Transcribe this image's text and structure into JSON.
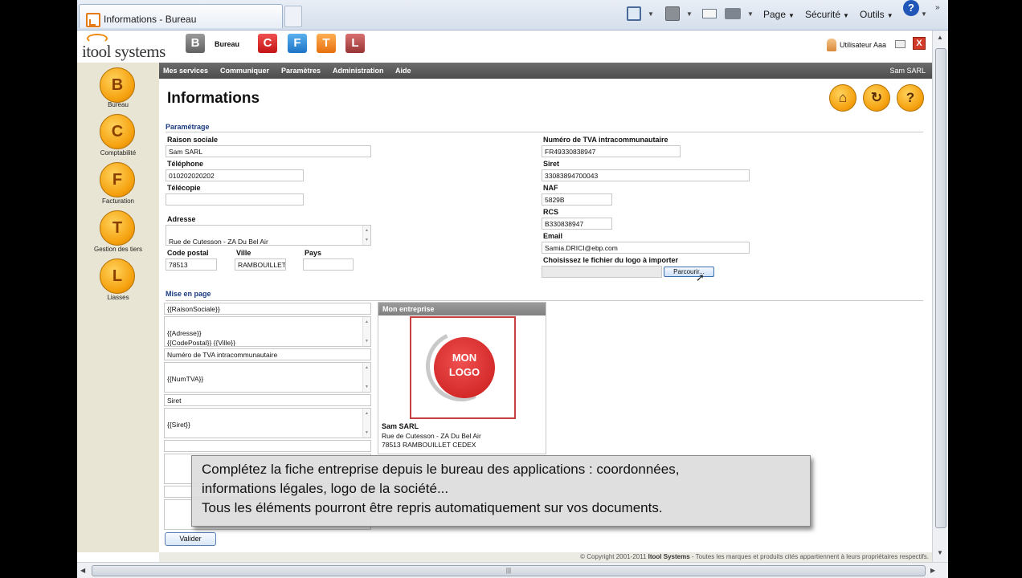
{
  "browser": {
    "tab_title": "Informations - Bureau",
    "menu": [
      "Page",
      "Sécurité",
      "Outils"
    ],
    "overflow": "»"
  },
  "header": {
    "logo_text": "itool systems",
    "apps": [
      {
        "letter": "B",
        "label": "Bureau"
      },
      {
        "letter": "C"
      },
      {
        "letter": "F"
      },
      {
        "letter": "T"
      },
      {
        "letter": "L"
      }
    ],
    "user": "Utilisateur Aaa",
    "close": "X"
  },
  "sidebar": {
    "items": [
      {
        "letter": "B",
        "label": "Bureau"
      },
      {
        "letter": "C",
        "label": "Comptabilité"
      },
      {
        "letter": "F",
        "label": "Facturation"
      },
      {
        "letter": "T",
        "label": "Gestion des tiers"
      },
      {
        "letter": "L",
        "label": "Liasses"
      }
    ]
  },
  "menubar": {
    "items": [
      "Mes services",
      "Communiquer",
      "Paramètres",
      "Administration",
      "Aide"
    ],
    "user": "Sam SARL"
  },
  "page": {
    "title": "Informations",
    "actions": [
      "home",
      "refresh",
      "help"
    ],
    "help_glyph": "?"
  },
  "parametrage": {
    "section_title": "Paramétrage",
    "raison_sociale": {
      "label": "Raison sociale",
      "value": "Sam SARL"
    },
    "telephone": {
      "label": "Téléphone",
      "value": "010202020202"
    },
    "telecopie": {
      "label": "Télécopie",
      "value": ""
    },
    "adresse": {
      "label": "Adresse",
      "value": "Rue de Cutesson - ZA Du Bel Air"
    },
    "code_postal": {
      "label": "Code postal",
      "value": "78513"
    },
    "ville": {
      "label": "Ville",
      "value": "RAMBOUILLET"
    },
    "pays": {
      "label": "Pays",
      "value": ""
    },
    "tva": {
      "label": "Numéro de TVA intracommunautaire",
      "value": "FR49330838947"
    },
    "siret": {
      "label": "Siret",
      "value": "33083894700043"
    },
    "naf": {
      "label": "NAF",
      "value": "5829B"
    },
    "rcs": {
      "label": "RCS",
      "value": "B330838947"
    },
    "email": {
      "label": "Email",
      "value": "Samia.DRICI@ebp.com"
    },
    "logo": {
      "label": "Choisissez le fichier du logo à importer",
      "button": "Parcourir..."
    }
  },
  "mise_en_page": {
    "section_title": "Mise en page",
    "fields": {
      "raison": "{{RaisonSociale}}",
      "adresse_block": "{{Adresse}}\n{{CodePostal}} {{Ville}}\n{{Pays}}",
      "tva_title": "Numéro de TVA intracommunautaire",
      "tva_block": "{{NumTVA}}",
      "siret_title": "Siret",
      "siret_block": "{{Siret}}"
    },
    "preview": {
      "header": "Mon entreprise",
      "logo_line1": "MON",
      "logo_line2": "LOGO",
      "company": "Sam SARL",
      "address1": "Rue de Cutesson - ZA Du Bel Air",
      "address2": "78513 RAMBOUILLET CEDEX"
    },
    "submit": "Valider"
  },
  "caption": {
    "line1": "Complétez la fiche entreprise depuis le bureau des applications : coordonnées,",
    "line2": "informations légales, logo de la société...",
    "line3": "Tous les éléments pourront être repris automatiquement sur vos documents."
  },
  "footer": {
    "copyright": "© Copyright 2001-2011",
    "company": "Itool Systems",
    "rest": " - Toutes les marques et produits cités appartiennent à leurs propriétaires respectifs."
  },
  "colors": {
    "accent_orange": "#f5a10f",
    "menu_bar": "#5a5a5a",
    "section_blue": "#1a3a80",
    "sidebar_bg": "#e8e5d4"
  },
  "icons": {
    "home": "home-icon",
    "rss": "rss-icon",
    "mail": "mail-icon",
    "print": "print-icon",
    "help": "help-icon",
    "user": "user-icon",
    "envelope": "envelope-icon",
    "close": "close-icon"
  }
}
